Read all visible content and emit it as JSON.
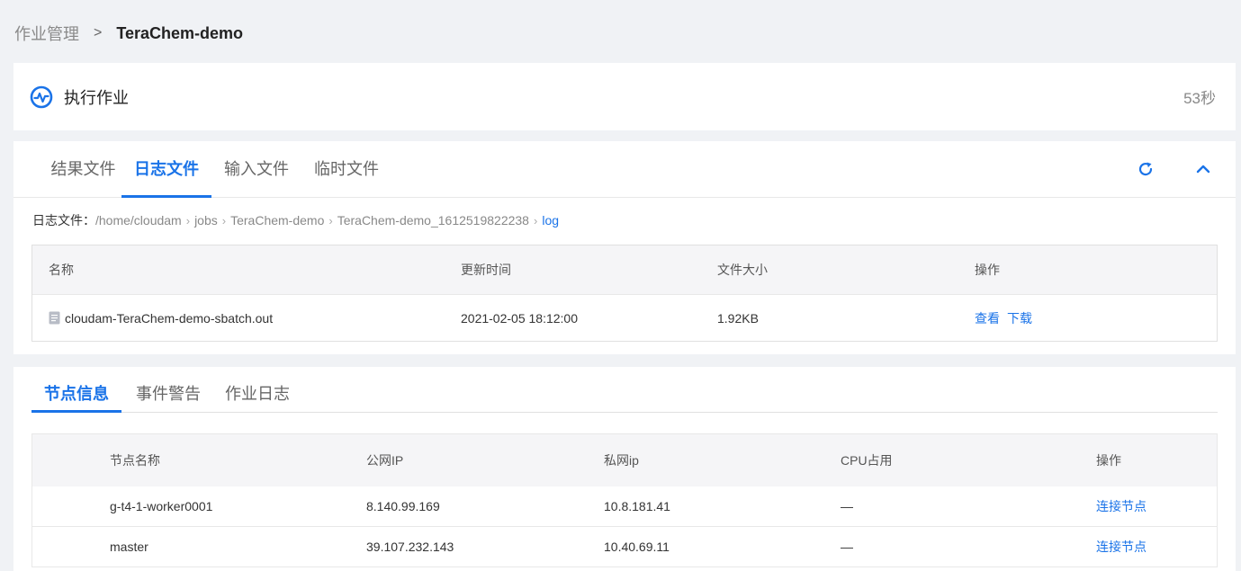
{
  "breadcrumb": {
    "parent": "作业管理",
    "separator": ">",
    "current": "TeraChem-demo"
  },
  "status": {
    "title": "执行作业",
    "elapsed": "53秒",
    "icon": "pulse-circle-icon",
    "accent": "#1a73e8"
  },
  "file_tabs": [
    {
      "label": "结果文件",
      "active": false
    },
    {
      "label": "日志文件",
      "active": true
    },
    {
      "label": "输入文件",
      "active": false
    },
    {
      "label": "临时文件",
      "active": false
    }
  ],
  "toolbar": {
    "refresh_icon": "refresh-icon",
    "collapse_icon": "chevron-up-icon"
  },
  "path": {
    "label": "日志文件：",
    "segments": [
      "/home/cloudam",
      "jobs",
      "TeraChem-demo",
      "TeraChem-demo_1612519822238",
      "log"
    ]
  },
  "file_table": {
    "columns": [
      "名称",
      "更新时间",
      "文件大小",
      "操作"
    ],
    "rows": [
      {
        "name": "cloudam-TeraChem-demo-sbatch.out",
        "updated": "2021-02-05 18:12:00",
        "size": "1.92KB",
        "view": "查看",
        "download": "下载"
      }
    ]
  },
  "node_tabs": [
    {
      "label": "节点信息",
      "active": true
    },
    {
      "label": "事件警告",
      "active": false
    },
    {
      "label": "作业日志",
      "active": false
    }
  ],
  "node_table": {
    "columns": [
      "节点名称",
      "公网IP",
      "私网ip",
      "CPU占用",
      "操作"
    ],
    "rows": [
      {
        "name": "g-t4-1-worker0001",
        "public_ip": "8.140.99.169",
        "private_ip": "10.8.181.41",
        "cpu": "—",
        "action": "连接节点"
      },
      {
        "name": "master",
        "public_ip": "39.107.232.143",
        "private_ip": "10.40.69.11",
        "cpu": "—",
        "action": "连接节点"
      }
    ]
  }
}
